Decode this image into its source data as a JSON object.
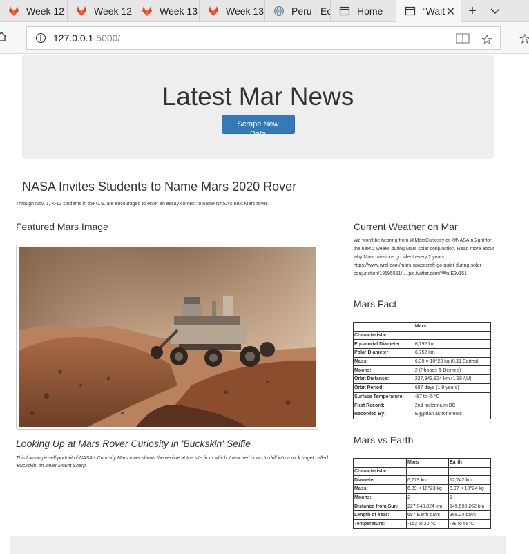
{
  "browser": {
    "tabs": [
      {
        "title": "Week 12",
        "icon": "gitlab-icon"
      },
      {
        "title": "Week 12",
        "icon": "gitlab-icon"
      },
      {
        "title": "Week 13",
        "icon": "gitlab-icon"
      },
      {
        "title": "Week 13",
        "icon": "gitlab-icon"
      },
      {
        "title": "Peru - Ec",
        "icon": "globe-icon"
      },
      {
        "title": "Home",
        "icon": "page-icon"
      },
      {
        "title": "“Wait",
        "icon": "page-icon"
      }
    ],
    "url_host": "127.0.0.1",
    "url_rest": ":5000/"
  },
  "jumbotron": {
    "title": "Latest Mar News",
    "button_label": "Scrape New Data"
  },
  "news": {
    "title": "NASA Invites Students to Name Mars 2020 Rover",
    "paragraph": "Through Nov. 1, K-12 students in the U.S. are encouraged to enter an essay contest to name NASA's next Mars rover."
  },
  "featured": {
    "heading": "Featured Mars Image",
    "image_title": "Looking Up at Mars Rover Curiosity in 'Buckskin' Selfie",
    "image_description": "This low-angle self-portrait of NASA's Curiosity Mars rover shows the vehicle at the site from which it reached down to drill into a rock target called 'Buckskin' on lower Mount Sharp."
  },
  "weather": {
    "heading": "Current Weather on Mar",
    "text": "We won't be hearing from @MarsCuriosity or @NASAInSight for the next 2 weeks during Mars solar conjunction. Read more about why Mars missions go silent every 2 years: https://www.wral.com/mars-spacecraft-go-quiet-during-solar-conjunction/18595551/ …pic.twitter.com/fWruE2v151"
  },
  "facts": {
    "heading": "Mars Fact",
    "tick": "'",
    "header": [
      "",
      "Mars"
    ],
    "index_label": "Characteristic",
    "rows": [
      [
        "Equatorial Diameter:",
        "6,792 km"
      ],
      [
        "Polar Diameter:",
        "6,752 km"
      ],
      [
        "Mass:",
        "6.39 × 10^23 kg (0.11 Earths)"
      ],
      [
        "Moons:",
        "2 (Phobos & Deimos)"
      ],
      [
        "Orbit Distance:",
        "227,943,824 km (1.38 AU)"
      ],
      [
        "Orbit Period:",
        "687 days (1.9 years)"
      ],
      [
        "Surface Temperature:",
        "-87 to -5 °C"
      ],
      [
        "First Record:",
        "2nd millennium BC"
      ],
      [
        "Recorded By:",
        "Egyptian astronomers"
      ]
    ]
  },
  "compare": {
    "heading": "Mars vs Earth",
    "tick": "'",
    "header": [
      "",
      "Mars",
      "Earth"
    ],
    "index_label": "Characteristic",
    "rows": [
      [
        "Diameter:",
        "6,779 km",
        "12,742 km"
      ],
      [
        "Mass:",
        "6.39 × 10^23 kg",
        "5.97 × 10^24 kg"
      ],
      [
        "Moons:",
        "2",
        "1"
      ],
      [
        "Distance from Sun:",
        "227,943,824 km",
        "149,598,262 km"
      ],
      [
        "Length of Year:",
        "687 Earth days",
        "365.24 days"
      ],
      [
        "Temperature:",
        "-153 to 20 °C",
        "-88 to 58°C"
      ]
    ]
  }
}
